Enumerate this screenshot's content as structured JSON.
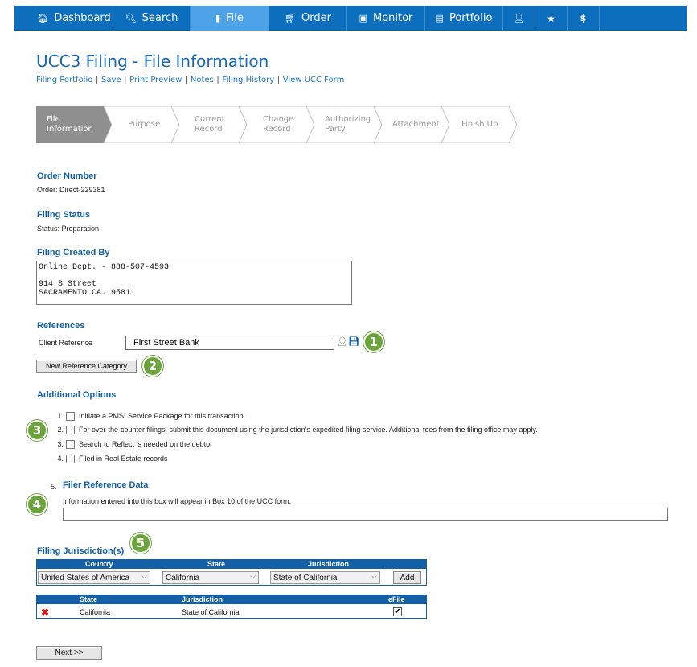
{
  "nav": {
    "items": [
      {
        "icon": "home-icon",
        "glyph": "🏠︎",
        "label": "Dashboard"
      },
      {
        "icon": "search-icon",
        "glyph": "🔍︎",
        "label": "Search"
      },
      {
        "icon": "file-icon",
        "glyph": "▮",
        "label": "File"
      },
      {
        "icon": "cart-icon",
        "glyph": "🛒︎",
        "label": "Order"
      },
      {
        "icon": "monitor-icon",
        "glyph": "▣",
        "label": "Monitor"
      },
      {
        "icon": "portfolio-icon",
        "glyph": "▤",
        "label": "Portfolio"
      }
    ],
    "icon_buttons": [
      {
        "icon": "user-icon",
        "glyph": "👤︎"
      },
      {
        "icon": "star-icon",
        "glyph": "★"
      },
      {
        "icon": "dollar-icon",
        "glyph": "$"
      }
    ],
    "active": "File"
  },
  "page": {
    "title": "UCC3 Filing - File Information",
    "links": [
      "Filing Portfolio",
      "Save",
      "Print Preview",
      "Notes",
      "Filing History",
      "View UCC Form"
    ]
  },
  "wizard": {
    "steps": [
      "File\nInformation",
      "Purpose",
      "Current\nRecord",
      "Change\nRecord",
      "Authorizing\nParty",
      "Attachment",
      "Finish Up"
    ],
    "active_index": 0
  },
  "order": {
    "heading": "Order Number",
    "value": "Order: Direct-229381"
  },
  "status": {
    "heading": "Filing Status",
    "value": "Status: Preparation"
  },
  "created_by": {
    "heading": "Filing Created By",
    "text": "Online Dept. - 888-507-4593\n\n914 S Street\nSACRAMENTO CA. 95811"
  },
  "references": {
    "heading": "References",
    "client_label": "Client Reference",
    "client_value": "First Street Bank",
    "new_category_button": "New Reference Category"
  },
  "additional": {
    "heading": "Additional Options",
    "options": [
      {
        "num": "1.",
        "label": "Initiate a PMSI Service Package for this transaction."
      },
      {
        "num": "2.",
        "label": "For over-the-counter filings, submit this document using the jurisdiction's expedited filing service. Additional fees from the filing office may apply."
      },
      {
        "num": "3.",
        "label": "Search to Reflect is needed on the debtor"
      },
      {
        "num": "4.",
        "label": "Filed in Real Estate records"
      }
    ],
    "filer_ref_num": "5.",
    "filer_ref_heading": "Filer Reference Data",
    "filer_ref_note": "Information entered into this box will appear in Box 10 of the UCC form."
  },
  "jurisdiction": {
    "heading": "Filing Jurisdiction(s)",
    "select_headers": [
      "Country",
      "State",
      "Jurisdiction"
    ],
    "country": "United States of America",
    "state": "California",
    "jurisdiction": "State of California",
    "add_button": "Add",
    "list_headers": [
      "State",
      "Jurisdiction",
      "eFile"
    ],
    "rows": [
      {
        "state": "California",
        "jurisdiction": "State of California",
        "efile": true
      }
    ]
  },
  "badges": [
    "1",
    "2",
    "3",
    "4",
    "5"
  ],
  "next_button": "Next >>",
  "colors": {
    "nav": "#0d6ebe",
    "nav_active": "#4da2e8",
    "heading": "#1460a8",
    "badge": "#6aa43b"
  }
}
